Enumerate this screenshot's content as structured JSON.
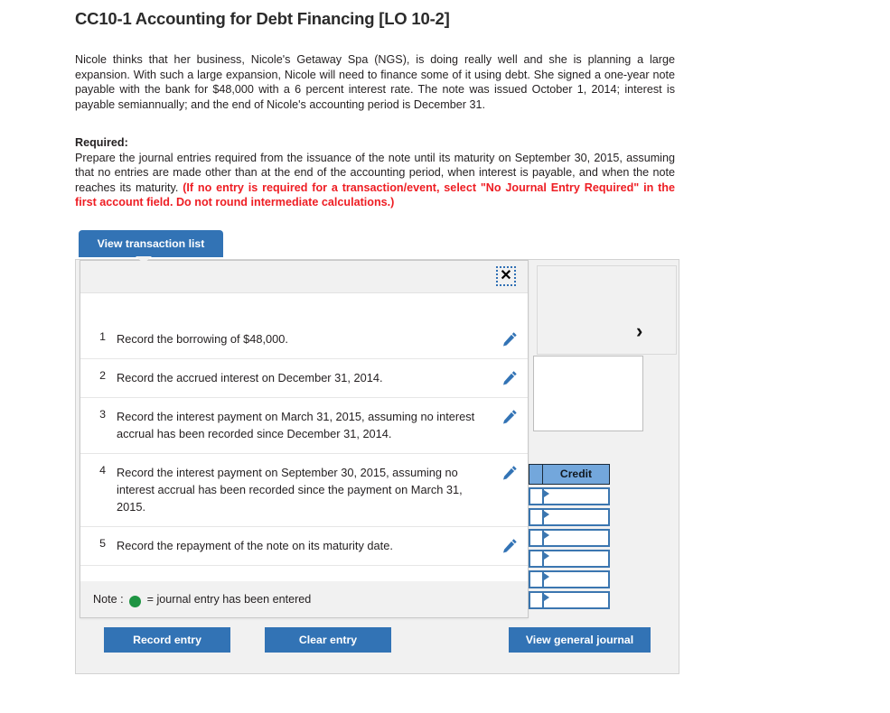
{
  "question": {
    "title": "CC10-1 Accounting for Debt Financing [LO 10-2]",
    "body": "Nicole thinks that her business, Nicole's Getaway Spa (NGS), is doing really well and she is planning a large expansion. With such a large expansion, Nicole will need to finance some of it using debt. She signed a one-year note payable with the bank for $48,000 with a 6 percent interest rate. The note was issued October 1, 2014; interest is payable semiannually; and the end of Nicole's accounting period is December 31.",
    "required_label": "Required:",
    "required_text": "Prepare the journal entries required from the issuance of the note until its maturity on September 30, 2015, assuming that no entries are made other than at the end of the accounting period, when interest is payable, and when the note reaches its maturity. ",
    "required_red": "(If no entry is required for a transaction/event, select \"No Journal Entry Required\" in the first account field. Do not round intermediate calculations.)"
  },
  "tab": {
    "label": "View transaction list"
  },
  "modal": {
    "close_label": "✕",
    "note_prefix": "Note :",
    "note_suffix": "= journal entry has been entered",
    "transactions": [
      {
        "num": "1",
        "desc": "Record the borrowing of $48,000."
      },
      {
        "num": "2",
        "desc": "Record the accrued interest on December 31, 2014."
      },
      {
        "num": "3",
        "desc": "Record the interest payment on March 31, 2015, assuming no interest accrual has been recorded since December 31, 2014."
      },
      {
        "num": "4",
        "desc": "Record the interest payment on September 30, 2015, assuming no interest accrual has been recorded since the payment on March 31, 2015."
      },
      {
        "num": "5",
        "desc": "Record the repayment of the note on its maturity date."
      }
    ]
  },
  "journal": {
    "credit_header": "Credit",
    "credit_rows": [
      "",
      "",
      "",
      "",
      "",
      ""
    ],
    "expand_icon": "›"
  },
  "buttons": {
    "record_entry": "Record entry",
    "clear_entry": "Clear entry",
    "view_general_journal": "View general journal"
  },
  "colors": {
    "primary_blue": "#3273b5",
    "header_blue": "#73a7dc",
    "cell_border_blue": "#3b76b0",
    "alert_red": "#ee1d23",
    "entered_green": "#1e9442",
    "panel_gray": "#f1f1f1"
  }
}
